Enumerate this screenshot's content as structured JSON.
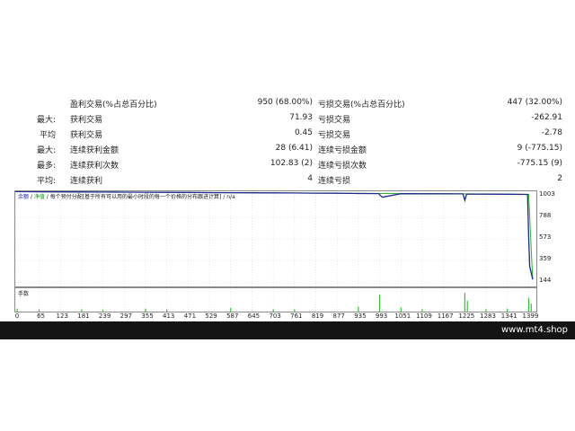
{
  "stats": {
    "rows": [
      {
        "label_a": "",
        "label_b": "盈利交易(%占总百分比)",
        "value_b": "950 (68.00%)",
        "label_c": "亏损交易(%占总百分比)",
        "value_c": "447 (32.00%)"
      },
      {
        "label_a": "最大:",
        "label_b": "获利交易",
        "value_b": "71.93",
        "label_c": "亏损交易",
        "value_c": "-262.91"
      },
      {
        "label_a": "平均",
        "label_b": "获利交易",
        "value_b": "0.45",
        "label_c": "亏损交易",
        "value_c": "-2.78"
      },
      {
        "label_a": "最大:",
        "label_b": "连续获利金额",
        "value_b": "28 (6.41)",
        "label_c": "连续亏损金额",
        "value_c": "9 (-775.15)"
      },
      {
        "label_a": "最多:",
        "label_b": "连续获利次数",
        "value_b": "102.83 (2)",
        "label_c": "连续亏损次数",
        "value_c": "-775.15 (9)"
      },
      {
        "label_a": "平均:",
        "label_b": "连续获利",
        "value_b": "4",
        "label_c": "连续亏损",
        "value_c": "2"
      }
    ]
  },
  "chart": {
    "legend": {
      "balance": "余额",
      "sep1": " / ",
      "equity": "净值",
      "sep2": " / ",
      "desc": "每个预付分配[基于所有可以用的最小时段的每一个价格的分布跟进计算]",
      "sep3": " / ",
      "na": "n/a"
    },
    "volume_label": "手数"
  },
  "chart_data": {
    "type": "line",
    "title": "",
    "x_ticks": [
      0,
      65,
      123,
      181,
      239,
      297,
      355,
      413,
      471,
      529,
      587,
      645,
      703,
      761,
      819,
      877,
      935,
      993,
      1051,
      1109,
      1167,
      1225,
      1283,
      1341,
      1399
    ],
    "y_ticks": [
      1003,
      788,
      573,
      359,
      144
    ],
    "xlim": [
      0,
      1420
    ],
    "ylim": [
      100,
      1050
    ],
    "series": [
      {
        "name": "余额",
        "x": [
          0,
          65,
          123,
          181,
          239,
          297,
          355,
          413,
          471,
          529,
          587,
          645,
          703,
          761,
          819,
          877,
          935,
          990,
          1000,
          1051,
          1109,
          1167,
          1220,
          1225,
          1230,
          1283,
          1341,
          1396,
          1399,
          1402,
          1410
        ],
        "y": [
          1046,
          1045,
          1044,
          1043,
          1042,
          1041,
          1040,
          1039,
          1038,
          1037,
          1036,
          1035,
          1034,
          1033,
          1031,
          1030,
          1028,
          1027,
          990,
          1026,
          1025,
          1025,
          1024,
          960,
          1022,
          1021,
          1020,
          1019,
          600,
          300,
          170
        ]
      },
      {
        "name": "净值",
        "x": [
          0,
          413,
          819,
          1225,
          1399,
          1410
        ],
        "y": [
          1046,
          1039,
          1031,
          1024,
          1019,
          170
        ]
      }
    ],
    "volume": {
      "name": "手数",
      "x": [
        5,
        65,
        181,
        239,
        355,
        413,
        587,
        703,
        761,
        935,
        993,
        1051,
        1109,
        1225,
        1232,
        1283,
        1341,
        1399,
        1406
      ],
      "y": [
        0.15,
        0.12,
        0.12,
        0.1,
        0.15,
        0.12,
        0.18,
        0.12,
        0.12,
        0.25,
        0.85,
        0.2,
        0.12,
        0.95,
        0.55,
        0.12,
        0.15,
        0.7,
        0.4
      ]
    }
  },
  "footer": {
    "site": "www.mt4.shop"
  },
  "colors": {
    "balance": "#1f2a8c",
    "equity": "#2db52d",
    "volume": "#35c235"
  }
}
